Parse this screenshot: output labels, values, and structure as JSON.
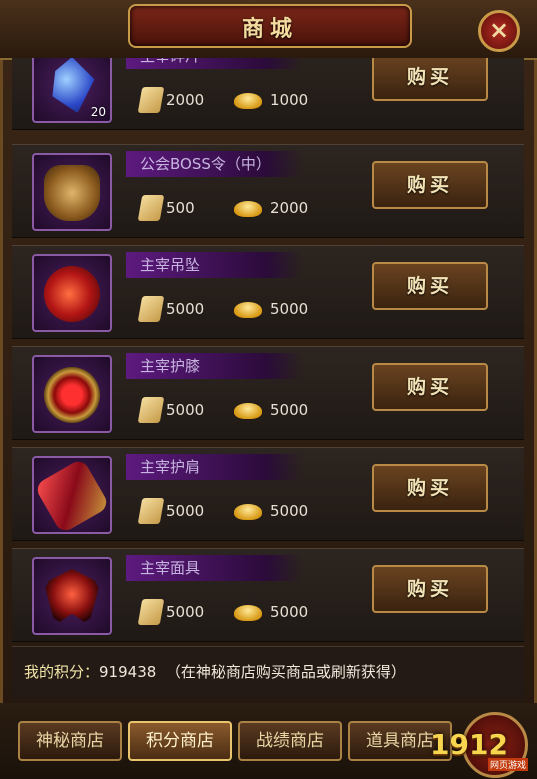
{
  "header": {
    "title": "商城",
    "close_label": "×"
  },
  "items": [
    {
      "name": "主宰碎片",
      "count": "20",
      "price_paper": "2000",
      "price_gold": "1000",
      "buy_label": "购买",
      "icon": "sapphire-shard-icon"
    },
    {
      "name": "公会BOSS令（中）",
      "count": "",
      "price_paper": "500",
      "price_gold": "2000",
      "buy_label": "购买",
      "icon": "guild-token-icon"
    },
    {
      "name": "主宰吊坠",
      "count": "",
      "price_paper": "5000",
      "price_gold": "5000",
      "buy_label": "购买",
      "icon": "pendant-icon"
    },
    {
      "name": "主宰护膝",
      "count": "",
      "price_paper": "5000",
      "price_gold": "5000",
      "buy_label": "购买",
      "icon": "kneeguard-icon"
    },
    {
      "name": "主宰护肩",
      "count": "",
      "price_paper": "5000",
      "price_gold": "5000",
      "buy_label": "购买",
      "icon": "shoulderguard-icon"
    },
    {
      "name": "主宰面具",
      "count": "",
      "price_paper": "5000",
      "price_gold": "5000",
      "buy_label": "购买",
      "icon": "mask-icon"
    }
  ],
  "points": {
    "label": "我的积分：",
    "value": "919438",
    "hint": "（在神秘商店购买商品或刷新获得）"
  },
  "tabs": [
    {
      "label": "神秘商店",
      "active": false
    },
    {
      "label": "积分商店",
      "active": true
    },
    {
      "label": "战绩商店",
      "active": false
    },
    {
      "label": "道具商店",
      "active": false
    }
  ],
  "watermark": {
    "logo": "1912",
    "sub": "网页游戏"
  }
}
